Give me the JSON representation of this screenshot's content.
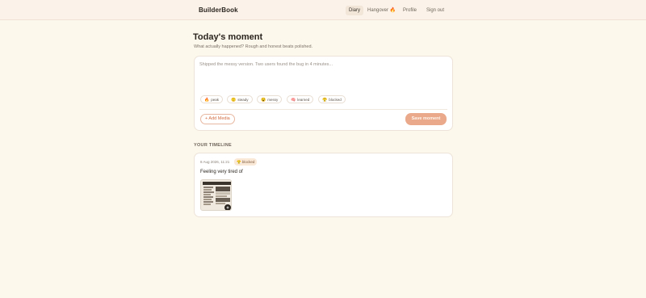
{
  "brand": {
    "name": "BuilderBook"
  },
  "nav": {
    "items": [
      {
        "label": "Diary",
        "active": true
      },
      {
        "label": "Hangover 🔥",
        "active": false
      },
      {
        "label": "Profile",
        "active": false
      },
      {
        "label": "Sign out",
        "active": false
      }
    ]
  },
  "page": {
    "title": "Today's moment",
    "subtitle": "What actually happened? Rough and honest beats polished."
  },
  "composer": {
    "placeholder": "Shipped the messy version. Two users found the bug in 4 minutes...",
    "moods": [
      {
        "emoji": "🔥",
        "label": "peak"
      },
      {
        "emoji": "🙂",
        "label": "steady"
      },
      {
        "emoji": "😵",
        "label": "messy"
      },
      {
        "emoji": "🧠",
        "label": "learned"
      },
      {
        "emoji": "😤",
        "label": "blocked"
      }
    ],
    "add_media_label": "+ Add Media",
    "save_label": "Save moment"
  },
  "timeline": {
    "heading": "YOUR TIMELINE",
    "entries": [
      {
        "date": "8 Aug 2026, 11:21",
        "mood_emoji": "😤",
        "mood_label": "blocked",
        "text": "Feeling very tired of"
      }
    ]
  },
  "colors": {
    "background": "#fdf8ec",
    "accent": "#eaa98a",
    "accent_text": "#d26f45"
  }
}
